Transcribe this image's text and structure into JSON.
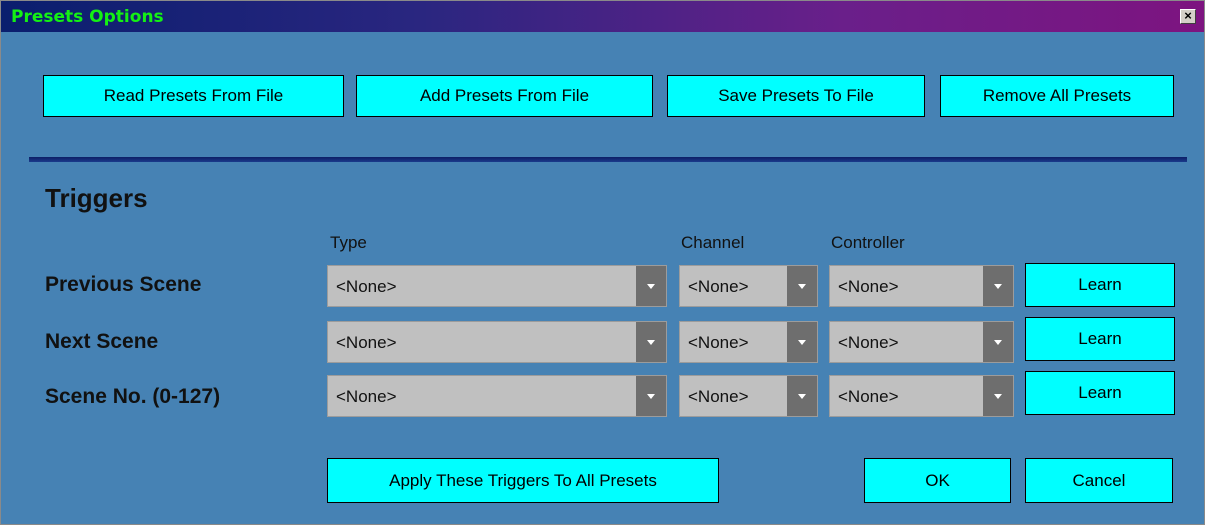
{
  "window": {
    "title": "Presets Options",
    "close_glyph": "×"
  },
  "toolbar": {
    "read_label": "Read Presets From File",
    "add_label": "Add Presets From File",
    "save_label": "Save Presets To File",
    "remove_label": "Remove All Presets"
  },
  "triggers": {
    "title": "Triggers",
    "columns": {
      "type": "Type",
      "channel": "Channel",
      "controller": "Controller"
    },
    "rows": [
      {
        "label": "Previous Scene",
        "type": "<None>",
        "channel": "<None>",
        "controller": "<None>",
        "learn": "Learn"
      },
      {
        "label": "Next Scene",
        "type": "<None>",
        "channel": "<None>",
        "controller": "<None>",
        "learn": "Learn"
      },
      {
        "label": "Scene No. (0-127)",
        "type": "<None>",
        "channel": "<None>",
        "controller": "<None>",
        "learn": "Learn"
      }
    ]
  },
  "footer": {
    "apply_label": "Apply These Triggers To All Presets",
    "ok_label": "OK",
    "cancel_label": "Cancel"
  },
  "colors": {
    "panel": "#4682b4",
    "button": "#00ffff",
    "title_text": "#14f014",
    "title_gradient": [
      "#0a1e6e",
      "#7d1480"
    ],
    "select_bg": "#c0c0c0",
    "select_arrow_bg": "#6e6e6e"
  },
  "icons": {
    "close": "close-icon",
    "dropdown": "chevron-down-icon"
  }
}
